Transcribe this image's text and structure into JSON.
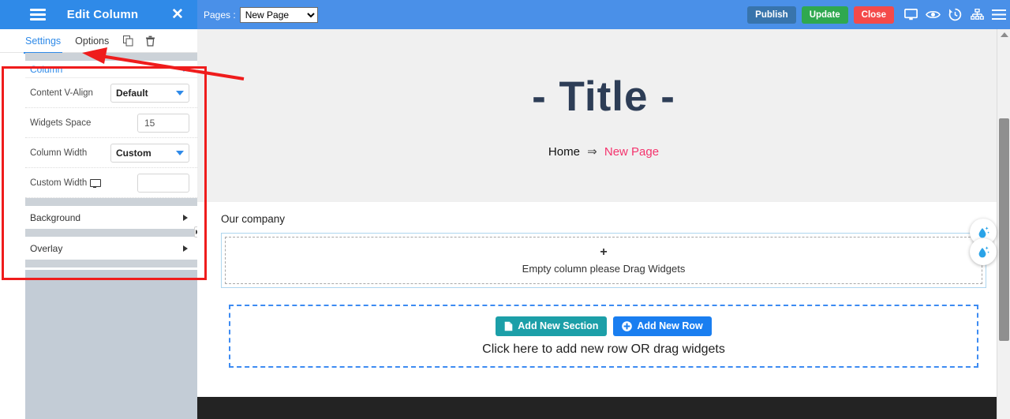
{
  "panel": {
    "title": "Edit Column",
    "menu_icon": "hamburger-icon",
    "close_icon": "close-icon",
    "tabs": [
      {
        "label": "Settings",
        "active": true
      },
      {
        "label": "Options",
        "active": false
      }
    ],
    "tool_icons": [
      "duplicate-icon",
      "trash-icon"
    ],
    "sections": {
      "column": {
        "label": "Column",
        "fields": [
          {
            "label": "Content V-Align",
            "type": "select",
            "value": "Default"
          },
          {
            "label": "Widgets Space",
            "type": "input",
            "value": "15"
          },
          {
            "label": "Column Width",
            "type": "select",
            "value": "Custom"
          },
          {
            "label": "Custom Width",
            "type": "input",
            "value": "",
            "icon": "monitor-icon"
          }
        ]
      },
      "accordions": [
        {
          "label": "Background"
        },
        {
          "label": "Overlay"
        }
      ]
    }
  },
  "topbar": {
    "pages_label": "Pages :",
    "pages_value": "New Page",
    "pages_options": [
      "New Page"
    ],
    "buttons": [
      {
        "label": "Publish",
        "color": "#3874ac"
      },
      {
        "label": "Update",
        "color": "#2fa84f"
      },
      {
        "label": "Close",
        "color": "#f44a4a"
      }
    ],
    "icons": [
      "desktop-icon",
      "eye-preview-icon",
      "history-revision-icon",
      "sitemap-icon",
      "menu-icon"
    ]
  },
  "canvas": {
    "hero": {
      "title": "- Title -",
      "breadcrumb_home": "Home",
      "breadcrumb_sep": "⇒",
      "breadcrumb_current": "New Page"
    },
    "section": {
      "title": "Our company",
      "empty_column_plus": "+",
      "empty_column_hint": "Empty column please Drag Widgets"
    },
    "addzone": {
      "add_section_label": "Add New Section",
      "add_section_icon": "file-icon",
      "add_row_label": "Add New Row",
      "add_row_icon": "plus-circle-icon",
      "hint": "Click here to add new row OR drag widgets"
    },
    "float_buttons": [
      {
        "icon": "water-drop-icon"
      },
      {
        "icon": "water-drop-icon"
      }
    ]
  },
  "colors": {
    "accent_blue": "#2f8ae8",
    "topbar_blue": "#4a90e8",
    "publish": "#3874ac",
    "update": "#2fa84f",
    "close": "#f44a4a",
    "annotation_red": "#ef1c1c",
    "breadcrumb_pink": "#f4336d",
    "hero_navy": "#2d3d56",
    "add_section_teal": "#1c9fa8",
    "add_row_blue": "#1a7ef0"
  }
}
